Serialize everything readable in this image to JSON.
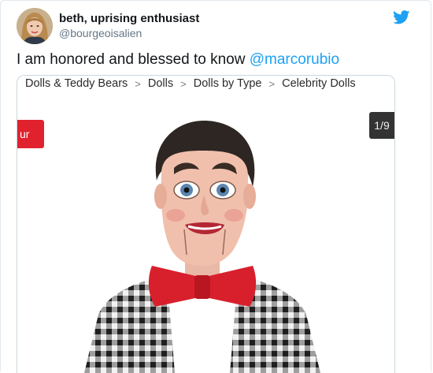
{
  "author": {
    "display_name": "beth, uprising enthusiast",
    "handle": "@bourgeoisalien"
  },
  "tweet": {
    "text": "I am honored and blessed to know ",
    "mention": "@marcorubio"
  },
  "media": {
    "breadcrumb": [
      "Dolls & Teddy Bears",
      "Dolls",
      "Dolls by Type",
      "Celebrity Dolls"
    ],
    "separator": ">",
    "red_tab_text": "ur",
    "counter": "1/9"
  },
  "icons": {
    "platform": "twitter-bird-icon"
  },
  "colors": {
    "accent": "#1da1f2",
    "red_tab": "#e0222e",
    "bowtie": "#d8202c"
  }
}
